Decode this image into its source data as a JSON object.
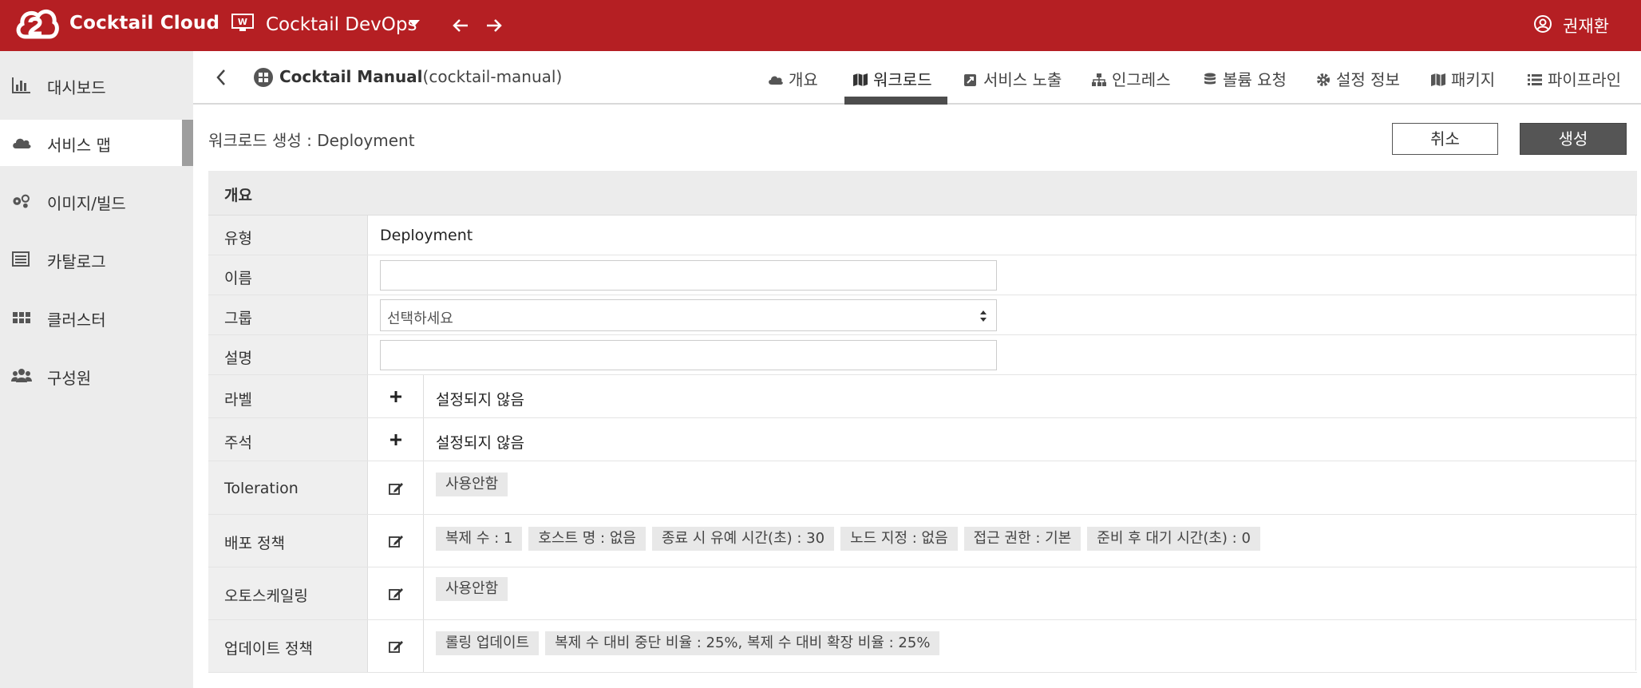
{
  "app": {
    "brand": "Cocktail Cloud",
    "workspace": "Cocktail DevOps",
    "user": "권재환"
  },
  "colors": {
    "topbar": "#b51f23",
    "active_tab": "#4d4d4d",
    "create_button": "#555555"
  },
  "sidebar": {
    "items": [
      {
        "label": "대시보드",
        "icon": "bar-chart-icon"
      },
      {
        "label": "서비스 맵",
        "icon": "cloud-icon",
        "active": true
      },
      {
        "label": "이미지/빌드",
        "icon": "cogs-icon"
      },
      {
        "label": "카탈로그",
        "icon": "list-alt-icon"
      },
      {
        "label": "클러스터",
        "icon": "grid-icon"
      },
      {
        "label": "구성원",
        "icon": "users-icon"
      }
    ]
  },
  "project": {
    "name": "Cocktail Manual",
    "id": "(cocktail-manual)",
    "tabs": [
      {
        "label": "개요",
        "icon": "cloud-icon"
      },
      {
        "label": "워크로드",
        "icon": "map-icon",
        "active": true
      },
      {
        "label": "서비스 노출",
        "icon": "external-link-icon"
      },
      {
        "label": "인그레스",
        "icon": "sitemap-icon"
      },
      {
        "label": "볼륨 요청",
        "icon": "database-icon"
      },
      {
        "label": "설정 정보",
        "icon": "gear-icon"
      },
      {
        "label": "패키지",
        "icon": "map-icon"
      },
      {
        "label": "파이프라인",
        "icon": "list-icon"
      }
    ]
  },
  "form": {
    "title": "워크로드 생성 : Deployment",
    "cancel_label": "취소",
    "create_label": "생성",
    "section": "개요",
    "type_label": "유형",
    "type_value": "Deployment",
    "name_label": "이름",
    "name_value": "",
    "group_label": "그룹",
    "group_placeholder": "선택하세요",
    "desc_label": "설명",
    "desc_value": "",
    "label_label": "라벨",
    "label_value": "설정되지 않음",
    "annotation_label": "주석",
    "annotation_value": "설정되지 않음",
    "toleration_label": "Toleration",
    "toleration_chip": "사용안함",
    "deploy_label": "배포 정책",
    "deploy_chips": [
      "복제 수 : 1",
      "호스트 명 : 없음",
      "종료 시 유예 시간(초) : 30",
      "노드 지정 : 없음",
      "접근 권한 : 기본",
      "준비 후 대기 시간(초) : 0"
    ],
    "autoscale_label": "오토스케일링",
    "autoscale_chip": "사용안함",
    "update_label": "업데이트 정책",
    "update_chips": [
      "롤링 업데이트",
      "복제 수 대비 중단 비율 : 25%, 복제 수 대비 확장 비율 : 25%"
    ]
  }
}
